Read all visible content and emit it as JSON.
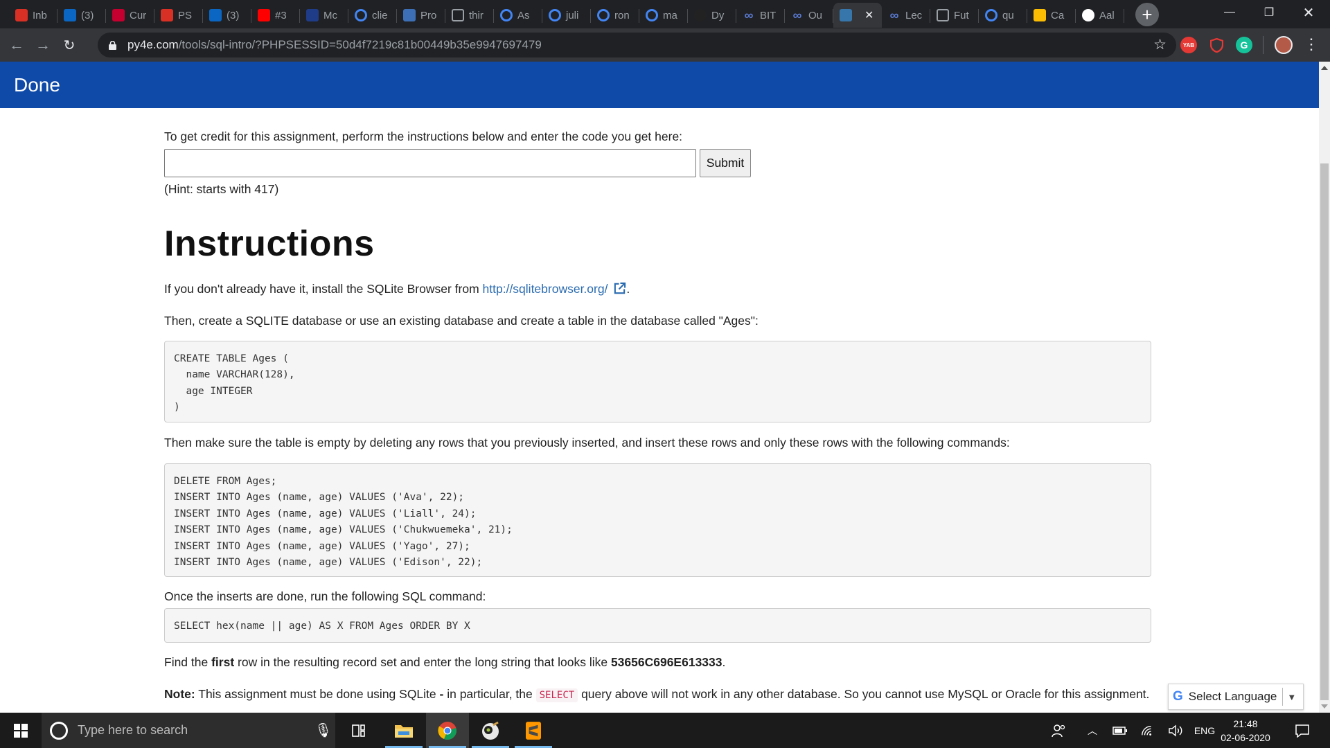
{
  "browser": {
    "tabs": [
      {
        "label": "Inb",
        "icon": "gmail-icon",
        "color": "#d93025"
      },
      {
        "label": "(3)",
        "icon": "linkedin-icon",
        "color": "#0a66c2"
      },
      {
        "label": "Cur",
        "icon": "angular-icon",
        "color": "#c3002f"
      },
      {
        "label": "PS",
        "icon": "gmail-icon",
        "color": "#d93025"
      },
      {
        "label": "(3)",
        "icon": "linkedin-icon",
        "color": "#0a66c2"
      },
      {
        "label": "#3",
        "icon": "youtube-icon",
        "color": "#ff0000"
      },
      {
        "label": "Mc",
        "icon": "mail-icon",
        "color": "#1f3c88"
      },
      {
        "label": "clie",
        "icon": "google-icon",
        "color": "#4285f4"
      },
      {
        "label": "Pro",
        "icon": "jsfiddle-icon",
        "color": "#3d6fb6"
      },
      {
        "label": "thir",
        "icon": "image-icon",
        "color": "#9aa0a6"
      },
      {
        "label": "As",
        "icon": "google-icon",
        "color": "#4285f4"
      },
      {
        "label": "juli",
        "icon": "google-icon",
        "color": "#4285f4"
      },
      {
        "label": "ron",
        "icon": "google-icon",
        "color": "#4285f4"
      },
      {
        "label": "ma",
        "icon": "google-icon",
        "color": "#4285f4"
      },
      {
        "label": "Dy",
        "icon": "avatar-icon",
        "color": "#222222"
      },
      {
        "label": "BIT",
        "icon": "infinity-icon",
        "color": "#5b7bd5"
      },
      {
        "label": "Ou",
        "icon": "infinity-icon",
        "color": "#5b7bd5"
      },
      {
        "label": "",
        "icon": "python-icon",
        "color": "#3776ab",
        "active": true
      },
      {
        "label": "Lec",
        "icon": "infinity-icon",
        "color": "#5b7bd5"
      },
      {
        "label": "Fut",
        "icon": "building-icon",
        "color": "#9aa0a6"
      },
      {
        "label": "qu",
        "icon": "google-icon",
        "color": "#4285f4"
      },
      {
        "label": "Ca",
        "icon": "drive-icon",
        "color": "#fbbc04"
      },
      {
        "label": "Aal",
        "icon": "github-icon",
        "color": "#ffffff"
      }
    ],
    "url_host": "py4e.com",
    "url_path": "/tools/sql-intro/?PHPSESSID=50d4f7219c81b00449b35e9947697479",
    "extensions": [
      {
        "name": "yab-extension-icon",
        "text": "YAB",
        "color": "#e53935"
      },
      {
        "name": "shield-extension-icon",
        "text": "",
        "color": "#e53935"
      },
      {
        "name": "grammarly-icon",
        "text": "G",
        "color": "#15c39a"
      }
    ]
  },
  "page": {
    "brand": "Done",
    "credit_text": "To get credit for this assignment, perform the instructions below and enter the code you get here:",
    "code_input_value": "",
    "submit_label": "Submit",
    "hint": "(Hint: starts with 417)",
    "heading": "Instructions",
    "install_prefix": "If you don't already have it, install the SQLite Browser from ",
    "install_link": "http://sqlitebrowser.org/",
    "install_suffix": ".",
    "create_text": "Then, create a SQLITE database or use an existing database and create a table in the database called \"Ages\":",
    "create_code": "CREATE TABLE Ages ( \n  name VARCHAR(128), \n  age INTEGER\n)",
    "empty_text": "Then make sure the table is empty by deleting any rows that you previously inserted, and insert these rows and only these rows with the following commands:",
    "insert_code": "DELETE FROM Ages;\nINSERT INTO Ages (name, age) VALUES ('Ava', 22);\nINSERT INTO Ages (name, age) VALUES ('Liall', 24);\nINSERT INTO Ages (name, age) VALUES ('Chukwuemeka', 21);\nINSERT INTO Ages (name, age) VALUES ('Yago', 27);\nINSERT INTO Ages (name, age) VALUES ('Edison', 22);",
    "run_text": "Once the inserts are done, run the following SQL command:",
    "select_code": "SELECT hex(name || age) AS X FROM Ages ORDER BY X",
    "find_prefix": "Find the ",
    "find_bold": "first",
    "find_middle": " row in the resulting record set and enter the long string that looks like ",
    "find_example": "53656C696E613333",
    "find_suffix": ".",
    "note_label": "Note:",
    "note_part1": " This assignment must be done using SQLite ",
    "note_dash": "-",
    "note_part2": " in particular, the ",
    "note_code": "SELECT",
    "note_part3": " query above will not work in any other database. So you cannot use MySQL or Oracle for this assignment.",
    "translate_label": "Select Language",
    "translate_g": "G"
  },
  "taskbar": {
    "search_placeholder": "Type here to search",
    "lang": "ENG",
    "time": "21:48",
    "date": "02-06-2020"
  }
}
